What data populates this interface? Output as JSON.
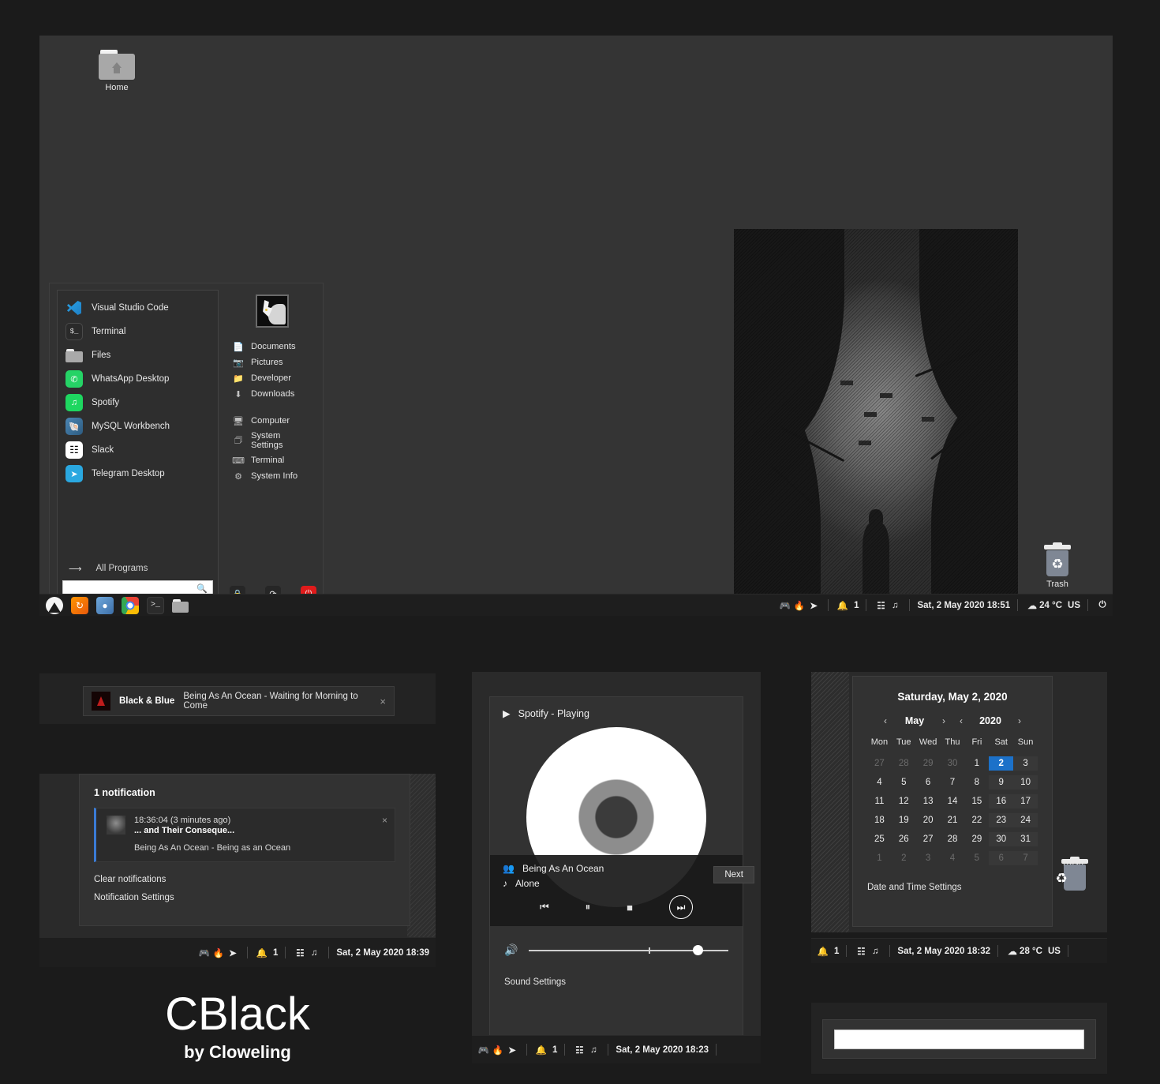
{
  "desktop": {
    "icons": [
      {
        "name": "Home",
        "type": "folder"
      },
      {
        "name": "Trash",
        "type": "trash"
      }
    ]
  },
  "start_menu": {
    "apps": [
      {
        "label": "Visual Studio Code",
        "icon": "vscode-icon"
      },
      {
        "label": "Terminal",
        "icon": "terminal-icon"
      },
      {
        "label": "Files",
        "icon": "files-icon"
      },
      {
        "label": "WhatsApp Desktop",
        "icon": "whatsapp-icon"
      },
      {
        "label": "Spotify",
        "icon": "spotify-icon"
      },
      {
        "label": "MySQL Workbench",
        "icon": "mysql-icon"
      },
      {
        "label": "Slack",
        "icon": "slack-icon"
      },
      {
        "label": "Telegram Desktop",
        "icon": "telegram-icon"
      }
    ],
    "all_programs": "All Programs",
    "search_placeholder": "",
    "search_value": "",
    "places": [
      {
        "label": "Documents",
        "icon": "document-icon"
      },
      {
        "label": "Pictures",
        "icon": "camera-icon"
      },
      {
        "label": "Developer",
        "icon": "folder-icon"
      },
      {
        "label": "Downloads",
        "icon": "download-icon"
      }
    ],
    "system": [
      {
        "label": "Computer",
        "icon": "monitor-icon"
      },
      {
        "label": "System Settings",
        "icon": "sliders-icon"
      },
      {
        "label": "Terminal",
        "icon": "terminal-icon"
      },
      {
        "label": "System Info",
        "icon": "gear-icon"
      }
    ],
    "power_buttons": [
      {
        "name": "lock",
        "glyph": "🔒"
      },
      {
        "name": "logout",
        "glyph": "⟳"
      },
      {
        "name": "shutdown",
        "glyph": "⏻"
      }
    ]
  },
  "taskbar": {
    "launchers": [
      {
        "name": "menu-icon"
      },
      {
        "name": "firefox-icon"
      },
      {
        "name": "browser-icon"
      },
      {
        "name": "chrome-icon"
      },
      {
        "name": "terminal-icon"
      },
      {
        "name": "files-icon"
      }
    ],
    "tray": {
      "discord": "discord-icon",
      "app": "app-icon",
      "telegram": "telegram-icon",
      "notification_count": "1",
      "network": "network-icon",
      "music": "music-note-icon"
    },
    "datetime": "Sat,  2 May 2020 18:51",
    "weather": "24 °C",
    "keyboard_layout": "US",
    "power_glyph": "⏻"
  },
  "notification_osd": {
    "app": "Black & Blue",
    "text": "Being As An Ocean - Waiting for Morning to Come",
    "close": "×"
  },
  "notification_panel": {
    "count_label": "1 notification",
    "item": {
      "time": "18:36:04 (3 minutes ago)",
      "title": "... and Their Conseque...",
      "body": "Being As An Ocean - Being as an Ocean",
      "close": "×"
    },
    "clear_label": "Clear notifications",
    "settings_label": "Notification Settings",
    "taskbar_datetime": "Sat,  2 May 2020 18:39",
    "taskbar_notification_count": "1"
  },
  "brand": {
    "name": "CBlack",
    "author": "by Cloweling"
  },
  "spotify_panel": {
    "header": "Spotify - Playing",
    "artist": "Being As An Ocean",
    "track": "Alone",
    "controls": [
      {
        "name": "previous-button",
        "glyph": "⏮"
      },
      {
        "name": "pause-button",
        "glyph": "⏸"
      },
      {
        "name": "stop-button",
        "glyph": "■"
      },
      {
        "name": "next-button",
        "glyph": "⏭"
      }
    ],
    "tooltip": "Next",
    "volume_percent": 82,
    "sound_settings": "Sound Settings",
    "taskbar_datetime": "Sat,  2 May 2020 18:23",
    "taskbar_notification_count": "1"
  },
  "calendar": {
    "title": "Saturday, May 2, 2020",
    "month": "May",
    "year": "2020",
    "prev_glyph": "‹",
    "next_glyph": "›",
    "weekdays": [
      "Mon",
      "Tue",
      "Wed",
      "Thu",
      "Fri",
      "Sat",
      "Sun"
    ],
    "weeks": [
      [
        {
          "d": "27",
          "dim": true
        },
        {
          "d": "28",
          "dim": true
        },
        {
          "d": "29",
          "dim": true
        },
        {
          "d": "30",
          "dim": true
        },
        {
          "d": "1"
        },
        {
          "d": "2",
          "today": true
        },
        {
          "d": "3",
          "we": true
        }
      ],
      [
        {
          "d": "4"
        },
        {
          "d": "5"
        },
        {
          "d": "6"
        },
        {
          "d": "7"
        },
        {
          "d": "8"
        },
        {
          "d": "9",
          "we": true
        },
        {
          "d": "10",
          "we": true
        }
      ],
      [
        {
          "d": "11"
        },
        {
          "d": "12"
        },
        {
          "d": "13"
        },
        {
          "d": "14"
        },
        {
          "d": "15"
        },
        {
          "d": "16",
          "we": true
        },
        {
          "d": "17",
          "we": true
        }
      ],
      [
        {
          "d": "18"
        },
        {
          "d": "19"
        },
        {
          "d": "20"
        },
        {
          "d": "21"
        },
        {
          "d": "22"
        },
        {
          "d": "23",
          "we": true
        },
        {
          "d": "24",
          "we": true
        }
      ],
      [
        {
          "d": "25"
        },
        {
          "d": "26"
        },
        {
          "d": "27"
        },
        {
          "d": "28"
        },
        {
          "d": "29"
        },
        {
          "d": "30",
          "we": true
        },
        {
          "d": "31",
          "we": true
        }
      ],
      [
        {
          "d": "1",
          "dim": true
        },
        {
          "d": "2",
          "dim": true
        },
        {
          "d": "3",
          "dim": true
        },
        {
          "d": "4",
          "dim": true
        },
        {
          "d": "5",
          "dim": true
        },
        {
          "d": "6",
          "dim": true,
          "we": true
        },
        {
          "d": "7",
          "dim": true,
          "we": true
        }
      ]
    ],
    "date_time_settings": "Date and Time Settings",
    "trash_label": "Trash",
    "taskbar_datetime": "Sat,  2 May 2020 18:32",
    "taskbar_weather": "28 °C",
    "taskbar_keyboard": "US",
    "taskbar_notification_count": "1"
  },
  "run_box": {
    "value": "",
    "placeholder": ""
  },
  "colors": {
    "desktop_bg": "#343434",
    "panel_bg": "#323232",
    "taskbar_bg": "#1e1e1e",
    "accent_blue": "#1c71c9",
    "accent_red": "#e01b1b",
    "notification_accent": "#3a7bd5"
  }
}
